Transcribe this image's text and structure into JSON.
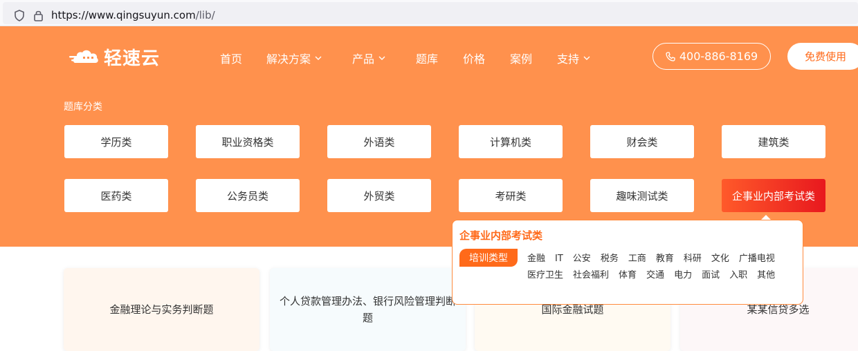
{
  "browser": {
    "url_main": "https://www.qingsuyun.com",
    "url_path": "/lib/"
  },
  "nav": {
    "logo_text": "轻速云",
    "items": [
      {
        "label": "首页",
        "has_dropdown": false
      },
      {
        "label": "解决方案",
        "has_dropdown": true
      },
      {
        "label": "产品",
        "has_dropdown": true
      },
      {
        "label": "题库",
        "has_dropdown": false
      },
      {
        "label": "价格",
        "has_dropdown": false
      },
      {
        "label": "案例",
        "has_dropdown": false
      },
      {
        "label": "支持",
        "has_dropdown": true
      }
    ],
    "phone": "400-886-8169",
    "free_button": "免费使用"
  },
  "categories": {
    "heading": "题库分类",
    "items": [
      "学历类",
      "职业资格类",
      "外语类",
      "计算机类",
      "财会类",
      "建筑类",
      "医药类",
      "公务员类",
      "外贸类",
      "考研类",
      "趣味测试类",
      "企事业内部考试类"
    ],
    "active_index": 11
  },
  "popup": {
    "title": "企事业内部考试类",
    "tag": "培训类型",
    "items": [
      "金融",
      "IT",
      "公安",
      "税务",
      "工商",
      "教育",
      "科研",
      "文化",
      "广播电视",
      "医疗卫生",
      "社会福利",
      "体育",
      "交通",
      "电力",
      "面试",
      "入职",
      "其他"
    ]
  },
  "cards": [
    {
      "title": "金融理论与实务判断题",
      "bg": "#fff6ee"
    },
    {
      "title": "个人贷款管理办法、银行风险管理判断题",
      "bg": "#f6fbfd"
    },
    {
      "title": "国际金融试题",
      "bg": "#fffaf2"
    },
    {
      "title": "某某信贷多选",
      "bg": "#fdf7f8"
    }
  ],
  "colors": {
    "hero_bg": "#ff914d",
    "accent": "#ff6a1a",
    "active_start": "#ff5a2a",
    "active_end": "#e8181e"
  }
}
